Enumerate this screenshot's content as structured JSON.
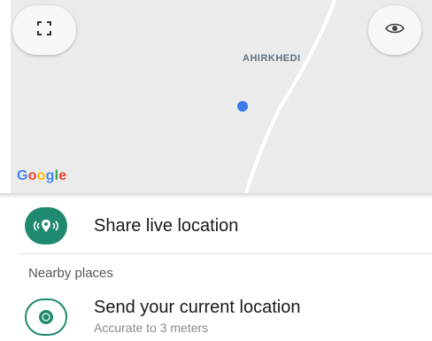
{
  "map": {
    "place_label": "AHIRKHEDI",
    "provider_logo": "Google",
    "fullscreen_icon": "fullscreen-icon",
    "locate_icon": "my-location-icon"
  },
  "share_live": {
    "label": "Share live location",
    "icon": "live-location-icon"
  },
  "nearby": {
    "header": "Nearby places"
  },
  "current_location": {
    "title": "Send your current location",
    "subtitle": "Accurate to 3 meters",
    "icon": "current-location-icon"
  },
  "colors": {
    "accent": "#1f8a6f",
    "location_dot": "#3a7be8",
    "map_background": "#ebebeb"
  }
}
